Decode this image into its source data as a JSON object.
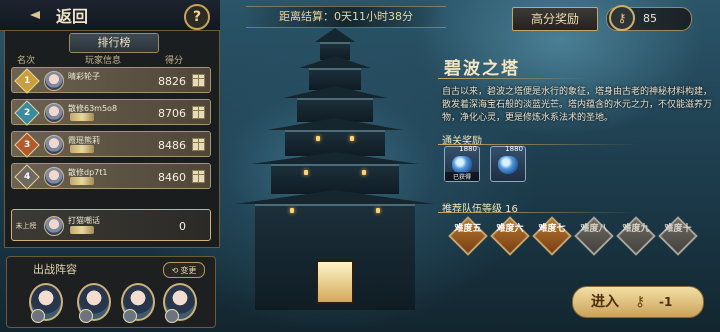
{
  "header": {
    "back_label": "返回",
    "help_label": "?"
  },
  "leaderboard": {
    "title": "排行榜",
    "col_rank": "名次",
    "col_player": "玩家信息",
    "col_score": "得分",
    "rows": [
      {
        "rank": "1",
        "name": "晴彩轮子",
        "title": "",
        "score": "8826",
        "badge_color": "#c8a03a"
      },
      {
        "rank": "2",
        "name": "散修63m5o8",
        "title": "",
        "score": "8706",
        "badge_color": "#3a8aa0"
      },
      {
        "rank": "3",
        "name": "霞瑶熊莉",
        "title": "",
        "score": "8486",
        "badge_color": "#b05a2e"
      },
      {
        "rank": "4",
        "name": "散修dp7t1",
        "title": "",
        "score": "8460",
        "badge_color": "#6e6a62"
      }
    ],
    "mine": {
      "rank": "未上榜",
      "name": "打猫嘲话",
      "title": "",
      "score": "0"
    }
  },
  "lineup": {
    "title": "出战阵容",
    "change_label": "变更",
    "hero_icons": [
      "hero-portrait-1",
      "hero-portrait-2",
      "hero-portrait-3",
      "hero-portrait-4"
    ]
  },
  "timer": {
    "text": "距离结算：0天11小时38分"
  },
  "top_right": {
    "reward_label": "高分奖励",
    "key_count": "85"
  },
  "tower": {
    "name": "碧波之塔",
    "description": "自古以来，碧波之塔便是水行的象征，塔身由古老的神秘材料构建，散发着深海宝石般的淡蓝光芒。塔内蕴含的水元之力，不仅能滋养万物，净化心灵，更是修炼水系法术的圣地。",
    "rewards_title": "通关奖励",
    "rewards": [
      {
        "qty": "1880",
        "tag": "已获得"
      },
      {
        "qty": "1880",
        "tag": ""
      }
    ],
    "recommend_label": "推荐队伍等级 16",
    "difficulties": [
      {
        "label": "难度五",
        "state": "on"
      },
      {
        "label": "难度六",
        "state": "on"
      },
      {
        "label": "难度七",
        "state": "on"
      },
      {
        "label": "难度八",
        "state": "off"
      },
      {
        "label": "难度九",
        "state": "off"
      },
      {
        "label": "难度十",
        "state": "off"
      }
    ],
    "enter_label": "进入",
    "enter_cost": "-1"
  },
  "colors": {
    "accent_gold": "#c8a560",
    "background": "#1d3a4a"
  }
}
